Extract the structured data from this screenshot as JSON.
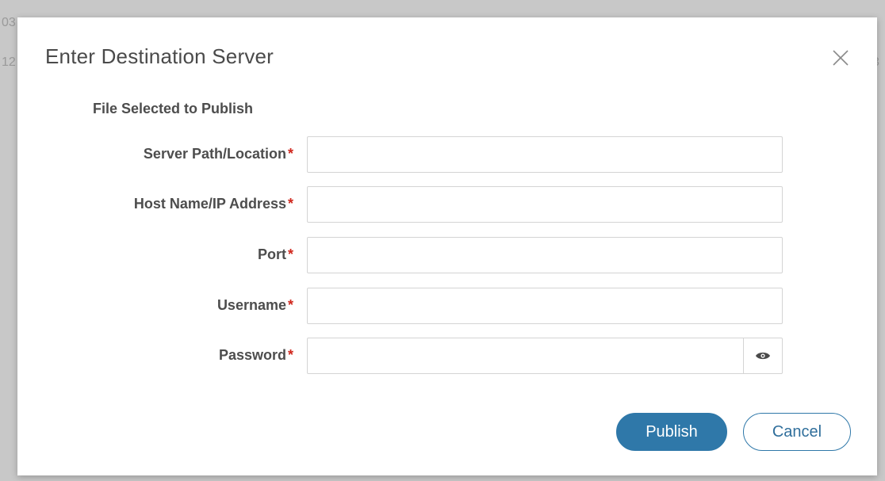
{
  "backdrop": {
    "fragments": [
      "03",
      "12",
      "3"
    ]
  },
  "dialog": {
    "title": "Enter Destination Server",
    "file_selected_label": "File Selected to Publish",
    "required_marker": "*",
    "fields": [
      {
        "label": "Server Path/Location",
        "value": "",
        "placeholder": ""
      },
      {
        "label": "Host Name/IP Address",
        "value": "",
        "placeholder": ""
      },
      {
        "label": "Port",
        "value": "",
        "placeholder": ""
      },
      {
        "label": "Username",
        "value": "",
        "placeholder": ""
      },
      {
        "label": "Password",
        "value": "",
        "placeholder": ""
      }
    ],
    "buttons": {
      "publish": "Publish",
      "cancel": "Cancel"
    }
  },
  "icons": {
    "close": "close-icon",
    "password_toggle": "eye-icon"
  },
  "colors": {
    "accent": "#2f78a9",
    "required": "#d0271d",
    "label_text": "#4d4d4d",
    "title_text": "#4a4a4a",
    "backdrop": "#c8c8c8"
  }
}
